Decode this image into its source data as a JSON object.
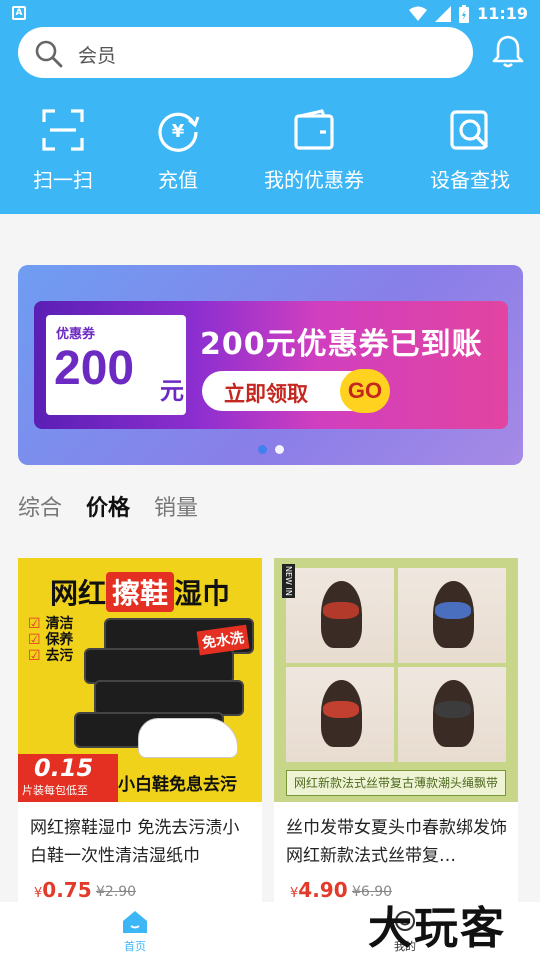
{
  "status_bar": {
    "notification_badge": "A",
    "time": "11:19"
  },
  "search": {
    "placeholder": "会员"
  },
  "quick_actions": [
    {
      "label": "扫一扫",
      "icon": "scan-icon"
    },
    {
      "label": "充值",
      "icon": "recharge-icon"
    },
    {
      "label": "我的优惠券",
      "icon": "wallet-icon"
    },
    {
      "label": "设备查找",
      "icon": "device-search-icon"
    }
  ],
  "banner": {
    "coupon_label": "优惠券",
    "coupon_value": "200",
    "coupon_unit": "元",
    "headline": "200元优惠券已到账",
    "cta": "立即领取",
    "go": "GO",
    "slides": 2,
    "active_slide": 1
  },
  "sort_tabs": [
    {
      "label": "综合",
      "active": false
    },
    {
      "label": "价格",
      "active": true
    },
    {
      "label": "销量",
      "active": false
    }
  ],
  "products": [
    {
      "title": "网红擦鞋湿巾 免洗去污渍小白鞋一次性清洁湿纸巾",
      "price_symbol": "¥",
      "price": "0.75",
      "old_price": "¥2.90",
      "image": {
        "title_a": "网红",
        "title_hl": "擦鞋",
        "title_b": "湿巾",
        "bullets": [
          "清洁",
          "保养",
          "去污"
        ],
        "badge": "免水洗",
        "promo_price": "0.15",
        "promo_note": "片装每包低至",
        "footer": "小白鞋免息去污"
      }
    },
    {
      "title": "丝巾发带女夏头巾春款绑发饰网红新款法式丝带复…",
      "price_symbol": "¥",
      "price": "4.90",
      "old_price": "¥6.90",
      "image": {
        "tag": "NEW IN",
        "band": "网红新款法式丝带复古薄款潮头绳飘带"
      }
    }
  ],
  "tab_bar": [
    {
      "label": "首页",
      "active": true
    },
    {
      "label": "我的",
      "active": false
    }
  ],
  "watermark": "大玩客",
  "colors": {
    "primary": "#3cb6f5",
    "price": "#e23b2b"
  }
}
